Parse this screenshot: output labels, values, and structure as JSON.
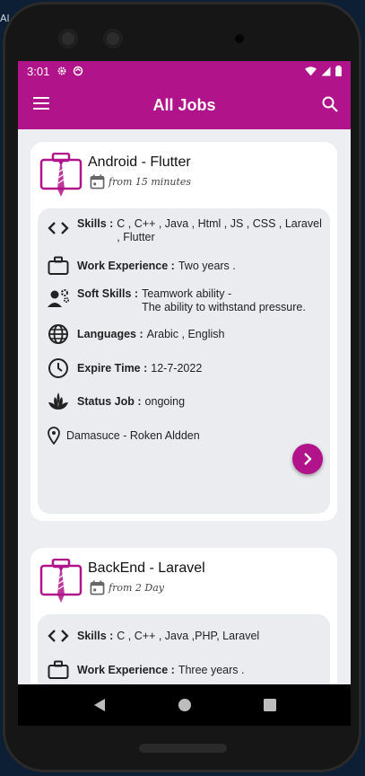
{
  "side_text": "Al",
  "status_bar": {
    "time": "3:01"
  },
  "app_bar": {
    "title": "All Jobs"
  },
  "jobs": [
    {
      "title": "Android - Flutter",
      "posted": "from 15 minutes",
      "skills_label": "Skills :",
      "skills": "C , C++ , Java , Html , JS , CSS , Laravel , Flutter",
      "work_experience_label": "Work Experience :",
      "work_experience": "Two years .",
      "soft_skills_label": "Soft Skills :",
      "soft_skills_line1": "Teamwork ability -",
      "soft_skills_line2": "The ability to withstand pressure.",
      "languages_label": "Languages :",
      "languages": "Arabic , English",
      "expire_time_label": "Expire Time :",
      "expire_time": "12-7-2022",
      "status_label": "Status Job :",
      "status": "ongoing",
      "location": "Damasuce - Roken Aldden"
    },
    {
      "title": "BackEnd - Laravel",
      "posted": "from 2 Day",
      "skills_label": "Skills :",
      "skills": "C , C++ , Java ,PHP, Laravel",
      "work_experience_label": "Work Experience :",
      "work_experience": "Three years ."
    }
  ],
  "colors": {
    "accent": "#b0138a",
    "background": "#eceef1",
    "card": "#ffffff",
    "inner_card": "#eaecef"
  },
  "icons": [
    "menu-icon",
    "search-icon",
    "briefcase-tie-icon",
    "calendar-icon",
    "code-icon",
    "briefcase-icon",
    "soft-skills-icon",
    "globe-icon",
    "clock-icon",
    "leaf-icon",
    "location-pin-icon",
    "chevron-right-icon",
    "back-icon",
    "home-icon",
    "recents-icon"
  ]
}
